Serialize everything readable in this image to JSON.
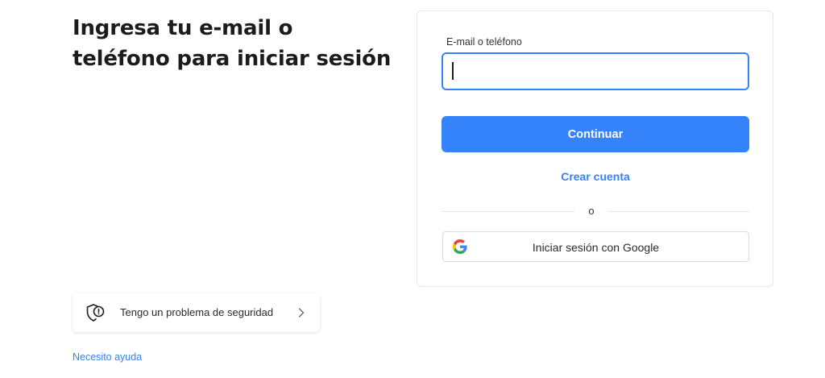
{
  "headline": "Ingresa tu e-mail o teléfono para iniciar sesión",
  "login": {
    "field_label": "E-mail o teléfono",
    "field_value": "",
    "continue_label": "Continuar",
    "create_account_label": "Crear cuenta",
    "divider_text": "o",
    "google_label": "Iniciar sesión con Google"
  },
  "security": {
    "label": "Tengo un problema de seguridad",
    "icon": "shield-alert-icon"
  },
  "help_link": "Necesito ayuda",
  "colors": {
    "accent": "#3483fa",
    "card_border": "#e6e6e6",
    "google_blue": "#4285F4",
    "google_red": "#EA4335",
    "google_yellow": "#FBBC05",
    "google_green": "#34A853"
  }
}
